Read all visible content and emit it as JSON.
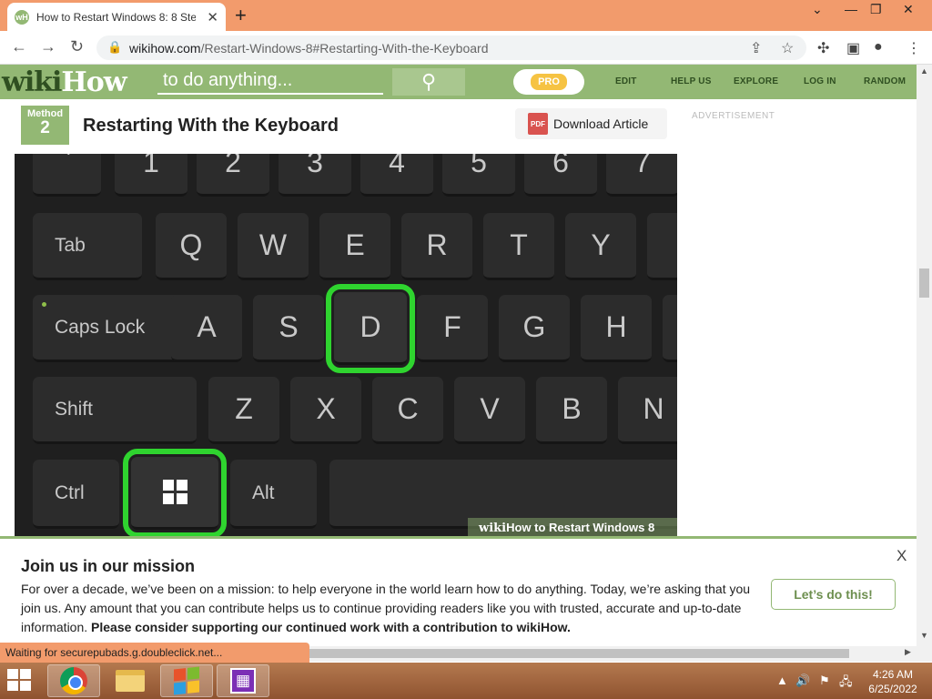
{
  "browser": {
    "tab_title": "How to Restart Windows 8: 8 Ste",
    "favicon_text": "wH",
    "url_domain": "wikihow.com",
    "url_path": "/Restart-Windows-8#Restarting-With-the-Keyboard"
  },
  "header": {
    "logo_wiki": "wiki",
    "logo_how": "How",
    "search_placeholder": "to do anything...",
    "pro_label": "PRO",
    "nav": [
      "EDIT",
      "HELP US",
      "EXPLORE",
      "LOG IN",
      "RANDOM"
    ]
  },
  "method": {
    "word": "Method",
    "number": "2",
    "title": "Restarting With the Keyboard",
    "pdf_label": "PDF",
    "download_label": "Download Article"
  },
  "ad": {
    "label": "ADVERTISEMENT"
  },
  "keyboard": {
    "row_numbers": [
      "`",
      "1",
      "2",
      "3",
      "4",
      "5",
      "6",
      "7"
    ],
    "row_top": [
      "Tab",
      "Q",
      "W",
      "E",
      "R",
      "T",
      "Y"
    ],
    "row_home": [
      "Caps Lock",
      "A",
      "S",
      "D",
      "F",
      "G",
      "H"
    ],
    "row_bottom": [
      "Shift",
      "Z",
      "X",
      "C",
      "V",
      "B",
      "N"
    ],
    "row_space": [
      "Ctrl",
      "Alt"
    ],
    "highlighted": [
      "D",
      "Windows"
    ],
    "watermark_wiki": "wiki",
    "watermark_how": "How",
    "watermark_text": " to Restart Windows 8"
  },
  "mission": {
    "title": "Join us in our mission",
    "body": "For over a decade, we’ve been on a mission: to help everyone in the world learn how to do anything. Today, we’re asking that you join us. Any amount that you can contribute helps us to continue providing readers like you with trusted, accurate and up-to-date information. ",
    "body_bold": "Please consider supporting our continued work with a contribution to wikiHow.",
    "cta": "Let’s do this!",
    "close": "X"
  },
  "status": {
    "text": "Waiting for securepubads.g.doubleclick.net..."
  },
  "taskbar": {
    "time": "4:26 AM",
    "date": "6/25/2022"
  },
  "colors": {
    "wikihow_green": "#93b874",
    "highlight_green": "#2fd42f",
    "browser_frame": "#f29b6c"
  }
}
